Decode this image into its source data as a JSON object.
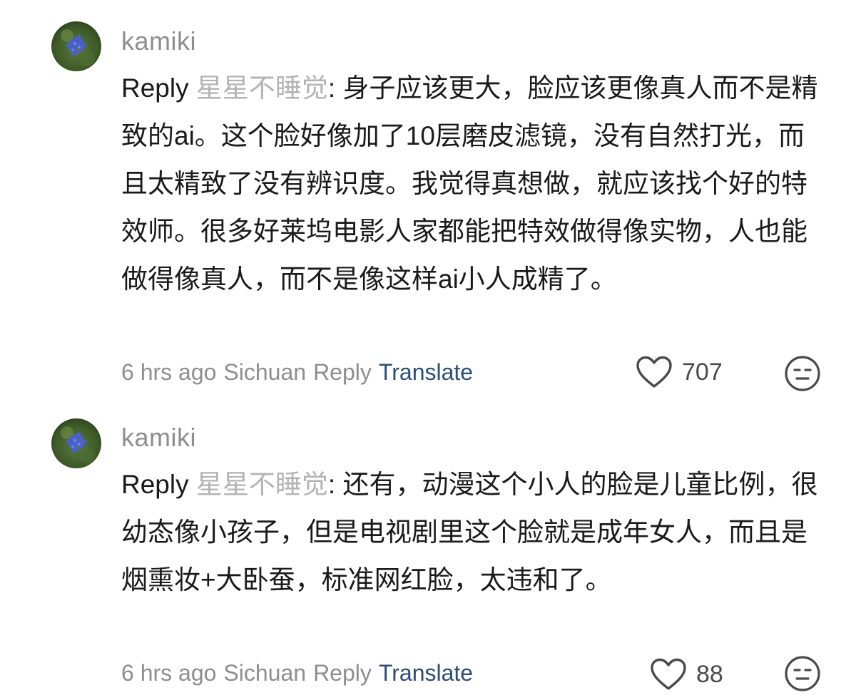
{
  "comments": [
    {
      "username": "kamiki",
      "reply_prefix": "Reply ",
      "reply_target": "星星不睡觉",
      "reply_colon": ": ",
      "text": "身子应该更大，脸应该更像真人而不是精致的ai。这个脸好像加了10层磨皮滤镜，没有自然打光，而且太精致了没有辨识度。我觉得真想做，就应该找个好的特效师。很多好莱坞电影人家都能把特效做得像实物，人也能做得像真人，而不是像这样ai小人成精了。",
      "time": "6 hrs ago",
      "location": "Sichuan",
      "reply_label": "Reply",
      "translate_label": "Translate",
      "likes": "707"
    },
    {
      "username": "kamiki",
      "reply_prefix": "Reply ",
      "reply_target": "星星不睡觉",
      "reply_colon": ": ",
      "text": "还有，动漫这个小人的脸是儿童比例，很幼态像小孩子，但是电视剧里这个脸就是成年女人，而且是烟熏妆+大卧蚕，标准网红脸，太违和了。",
      "time": "6 hrs ago",
      "location": "Sichuan",
      "reply_label": "Reply",
      "translate_label": "Translate",
      "likes": "88"
    }
  ],
  "icons": {
    "avatar": "flower-avatar-icon",
    "like": "heart-outline-icon",
    "react": "neutral-face-icon"
  },
  "colors": {
    "translate_link": "#2a4d78",
    "muted_text": "#8e8e8e",
    "reply_target": "#b3b3b3",
    "body_text": "#1a1a1a"
  }
}
